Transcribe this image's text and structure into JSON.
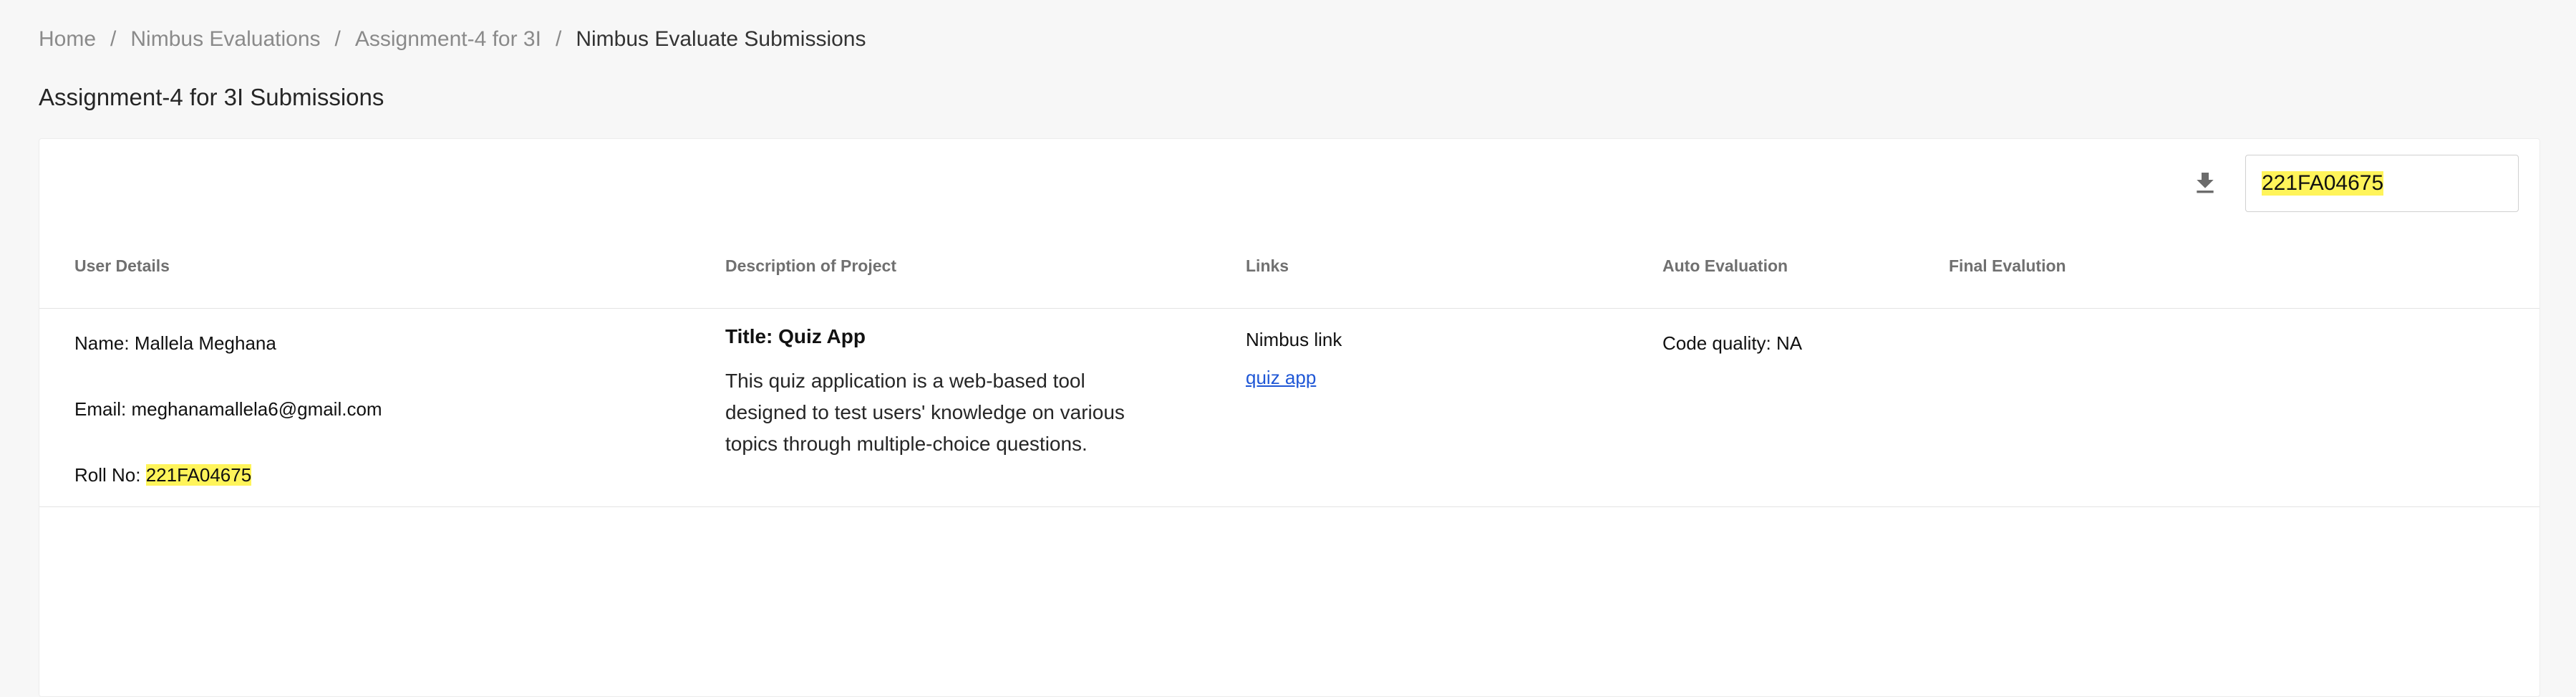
{
  "breadcrumb": {
    "items": [
      "Home",
      "Nimbus Evaluations",
      "Assignment-4 for 3I",
      "Nimbus Evaluate Submissions"
    ],
    "separator": "/"
  },
  "page_title": "Assignment-4 for 3I Submissions",
  "toolbar": {
    "download_icon": "download-icon",
    "search_value": "221FA04675"
  },
  "table": {
    "headers": [
      "User Details",
      "Description of Project",
      "Links",
      "Auto Evaluation",
      "Final Evalution"
    ],
    "rows": [
      {
        "name_label": "Name: ",
        "name": "Mallela Meghana",
        "email_label": "Email: ",
        "email": "meghanamallela6@gmail.com",
        "roll_label": "Roll No: ",
        "roll": "221FA04675",
        "title": "Title: Quiz App",
        "description": "This quiz application is a web-based tool designed to test users' knowledge on various topics through multiple-choice questions.",
        "links_heading": "Nimbus link",
        "link_text": "quiz app",
        "auto_eval": "Code quality: NA",
        "final_eval": ""
      }
    ]
  },
  "colors": {
    "highlight": "#fff45a",
    "link": "#1f57d6",
    "background": "#f7f7f7"
  }
}
